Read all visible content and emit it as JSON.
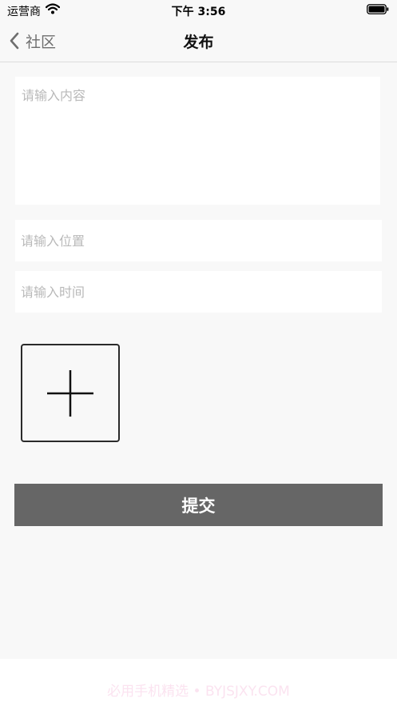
{
  "status_bar": {
    "carrier": "运营商",
    "time": "下午 3:56",
    "icons": [
      "wifi-icon",
      "battery-icon"
    ]
  },
  "nav": {
    "back_label": "社区",
    "title": "发布",
    "back_icon": "chevron-left-icon"
  },
  "form": {
    "content_placeholder": "请输入内容",
    "content_value": "",
    "location_placeholder": "请输入位置",
    "location_value": "",
    "time_placeholder": "请输入时间",
    "time_value": "",
    "add_image_icon": "plus-icon",
    "submit_label": "提交"
  },
  "watermark": "必用手机精选 • BYJSJXY.COM",
  "colors": {
    "background": "#f8f8f8",
    "submit_button": "#666666",
    "placeholder": "#b9b9b9"
  }
}
